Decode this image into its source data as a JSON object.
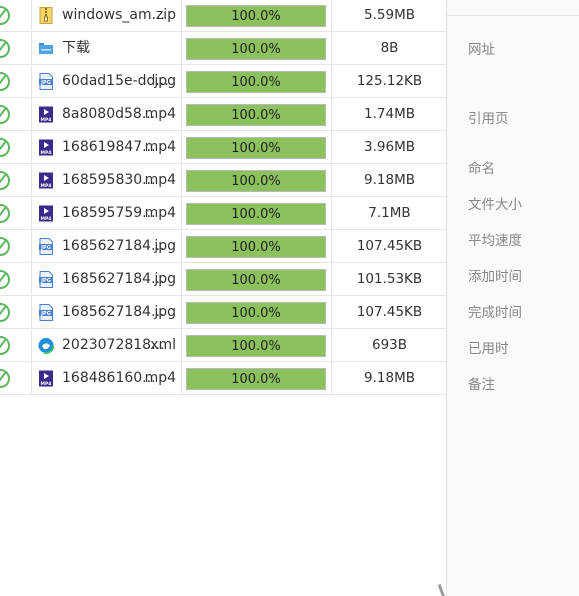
{
  "downloads": [
    {
      "icon": "zip-icon",
      "name": "windows_am...",
      "ext": "zip",
      "progress": 100.0,
      "progress_label": "100.0%",
      "size": "5.59MB"
    },
    {
      "icon": "folder-icon",
      "name": "下载",
      "ext": "",
      "progress": 100.0,
      "progress_label": "100.0%",
      "size": "8B"
    },
    {
      "icon": "jpg-icon",
      "name": "60dad15e-dd...",
      "ext": "jpg",
      "progress": 100.0,
      "progress_label": "100.0%",
      "size": "125.12KB"
    },
    {
      "icon": "mp4-icon",
      "name": "8a8080d58...",
      "ext": "mp4",
      "progress": 100.0,
      "progress_label": "100.0%",
      "size": "1.74MB"
    },
    {
      "icon": "mp4-icon",
      "name": "168619847...",
      "ext": "mp4",
      "progress": 100.0,
      "progress_label": "100.0%",
      "size": "3.96MB"
    },
    {
      "icon": "mp4-icon",
      "name": "168595830...",
      "ext": "mp4",
      "progress": 100.0,
      "progress_label": "100.0%",
      "size": "9.18MB"
    },
    {
      "icon": "mp4-icon",
      "name": "168595759...",
      "ext": "mp4",
      "progress": 100.0,
      "progress_label": "100.0%",
      "size": "7.1MB"
    },
    {
      "icon": "jpg-icon",
      "name": "1685627184...",
      "ext": "jpg",
      "progress": 100.0,
      "progress_label": "100.0%",
      "size": "107.45KB"
    },
    {
      "icon": "jpg-icon",
      "name": "1685627184...",
      "ext": "jpg",
      "progress": 100.0,
      "progress_label": "100.0%",
      "size": "101.53KB"
    },
    {
      "icon": "jpg-icon",
      "name": "1685627184...",
      "ext": "jpg",
      "progress": 100.0,
      "progress_label": "100.0%",
      "size": "107.45KB"
    },
    {
      "icon": "edge-icon",
      "name": "2023072818...",
      "ext": "xml",
      "progress": 100.0,
      "progress_label": "100.0%",
      "size": "693B"
    },
    {
      "icon": "mp4-icon",
      "name": "168486160...",
      "ext": "mp4",
      "progress": 100.0,
      "progress_label": "100.0%",
      "size": "9.18MB"
    }
  ],
  "details": {
    "url": "网址",
    "referer": "引用页",
    "name": "命名",
    "file_size": "文件大小",
    "avg_speed": "平均速度",
    "added_time": "添加时间",
    "completed_time": "完成时间",
    "elapsed": "已用时",
    "notes": "备注"
  },
  "colors": {
    "progress_fill": "#8cc25e",
    "done_check": "#5cb85c",
    "jpg_icon": "#4a7fcf",
    "mp4_icon": "#3a2a8c"
  }
}
